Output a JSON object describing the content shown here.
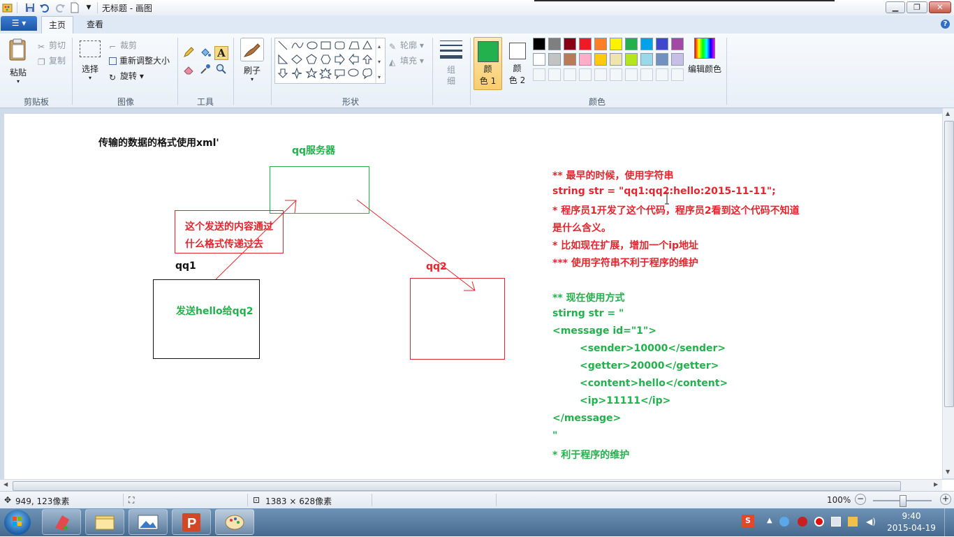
{
  "window": {
    "title": "无标题 - 画图",
    "controls": {
      "minimize": "▁",
      "maximize": "❐",
      "close": "✕"
    }
  },
  "tabs": {
    "file_icon": "☰",
    "home": "主页",
    "view": "查看",
    "help": "?"
  },
  "ribbon": {
    "clipboard": {
      "paste": "粘贴",
      "cut": "剪切",
      "copy": "复制",
      "group": "剪贴板"
    },
    "image": {
      "select": "选择",
      "crop": "裁剪",
      "resize": "重新调整大小",
      "rotate": "旋转",
      "group": "图像"
    },
    "tools": {
      "group": "工具"
    },
    "brushes": {
      "label": "刷子"
    },
    "shapes": {
      "outline": "轮廓",
      "fill": "填充",
      "group": "形状"
    },
    "size": {
      "label": "组\n细"
    },
    "colors": {
      "color1": "颜\n色 1",
      "color2": "颜\n色 2",
      "edit": "编辑颜色",
      "group": "颜色",
      "color1_value": "#22b14c",
      "color2_value": "#ffffff",
      "palette_row1": [
        "#000000",
        "#7f7f7f",
        "#880015",
        "#ed1c24",
        "#ff7f27",
        "#fff200",
        "#22b14c",
        "#00a2e8",
        "#3f48cc",
        "#a349a4"
      ],
      "palette_row2": [
        "#ffffff",
        "#c3c3c3",
        "#b97a57",
        "#ffaec9",
        "#ffc90e",
        "#efe4b0",
        "#b5e61d",
        "#99d9ea",
        "#7092be",
        "#c8bfe7"
      ]
    }
  },
  "canvas": {
    "heading": "传输的数据的格式使用xml'",
    "server_label": "qq服务器",
    "box_note_line1": "这个发送的内容通过",
    "box_note_line2": "什么格式传递过去",
    "qq1_label": "qq1",
    "qq1_text": "发送hello给qq2",
    "qq2_label": "qq2",
    "notes": [
      "** 最早的时候，使用字符串",
      "string str = \"qq1:qq2:hello:2015-11-11\";",
      "* 程序员1开发了这个代码，程序员2看到这个代码不知道",
      "是什么含义。",
      "* 比如现在扩展，增加一个ip地址",
      "*** 使用字符串不利于程序的维护"
    ],
    "xml_notes": [
      "** 现在使用方式",
      "stirng str = \"",
      "<message id=\"1\">",
      "        <sender>10000</sender>",
      "        <getter>20000</getter>",
      "        <content>hello</content>",
      "        <ip>11111</ip>",
      "</message>",
      "\"",
      "* 利于程序的维护"
    ]
  },
  "status": {
    "cursor_pos": "949, 123像素",
    "canvas_size": "1383 × 628像素",
    "zoom": "100%"
  },
  "taskbar": {
    "time": "9:40",
    "date": "2015-04-19"
  }
}
